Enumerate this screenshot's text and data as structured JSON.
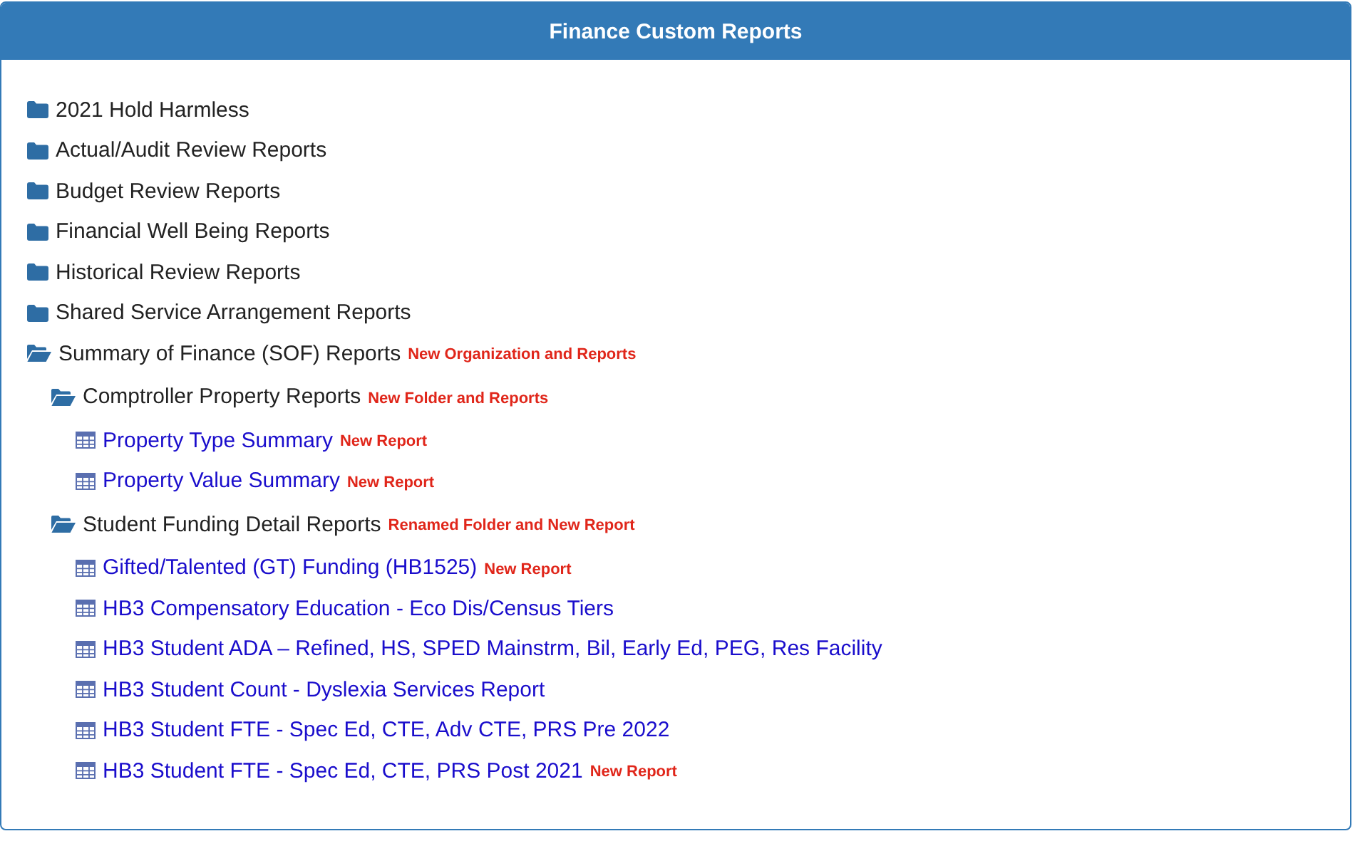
{
  "panel": {
    "title": "Finance Custom Reports"
  },
  "items": [
    {
      "kind": "folder",
      "label": "2021 Hold Harmless",
      "expanded": false
    },
    {
      "kind": "folder",
      "label": "Actual/Audit Review Reports",
      "expanded": false
    },
    {
      "kind": "folder",
      "label": "Budget Review Reports",
      "expanded": false
    },
    {
      "kind": "folder",
      "label": "Financial Well Being Reports",
      "expanded": false
    },
    {
      "kind": "folder",
      "label": "Historical Review Reports",
      "expanded": false
    },
    {
      "kind": "folder",
      "label": "Shared Service Arrangement Reports",
      "expanded": false
    },
    {
      "kind": "folder",
      "label": "Summary of Finance (SOF) Reports",
      "expanded": true,
      "tag": "New Organization and Reports",
      "children": [
        {
          "kind": "folder",
          "label": "Comptroller Property Reports",
          "expanded": true,
          "tag": "New Folder and Reports",
          "children": [
            {
              "kind": "report",
              "label": "Property Type Summary",
              "tag": "New Report"
            },
            {
              "kind": "report",
              "label": "Property Value Summary",
              "tag": "New Report"
            }
          ]
        },
        {
          "kind": "folder",
          "label": "Student Funding Detail Reports",
          "expanded": true,
          "tag": "Renamed Folder and New Report",
          "children": [
            {
              "kind": "report",
              "label": "Gifted/Talented (GT) Funding (HB1525)",
              "tag": "New Report"
            },
            {
              "kind": "report",
              "label": "HB3 Compensatory Education - Eco Dis/Census Tiers"
            },
            {
              "kind": "report",
              "label": "HB3 Student ADA – Refined, HS, SPED Mainstrm, Bil, Early Ed, PEG, Res Facility"
            },
            {
              "kind": "report",
              "label": "HB3 Student Count - Dyslexia Services Report"
            },
            {
              "kind": "report",
              "label": "HB3 Student FTE - Spec Ed, CTE, Adv CTE, PRS Pre 2022"
            },
            {
              "kind": "report",
              "label": "HB3 Student FTE - Spec Ed, CTE, PRS Post 2021",
              "tag": "New Report"
            }
          ]
        }
      ]
    }
  ]
}
